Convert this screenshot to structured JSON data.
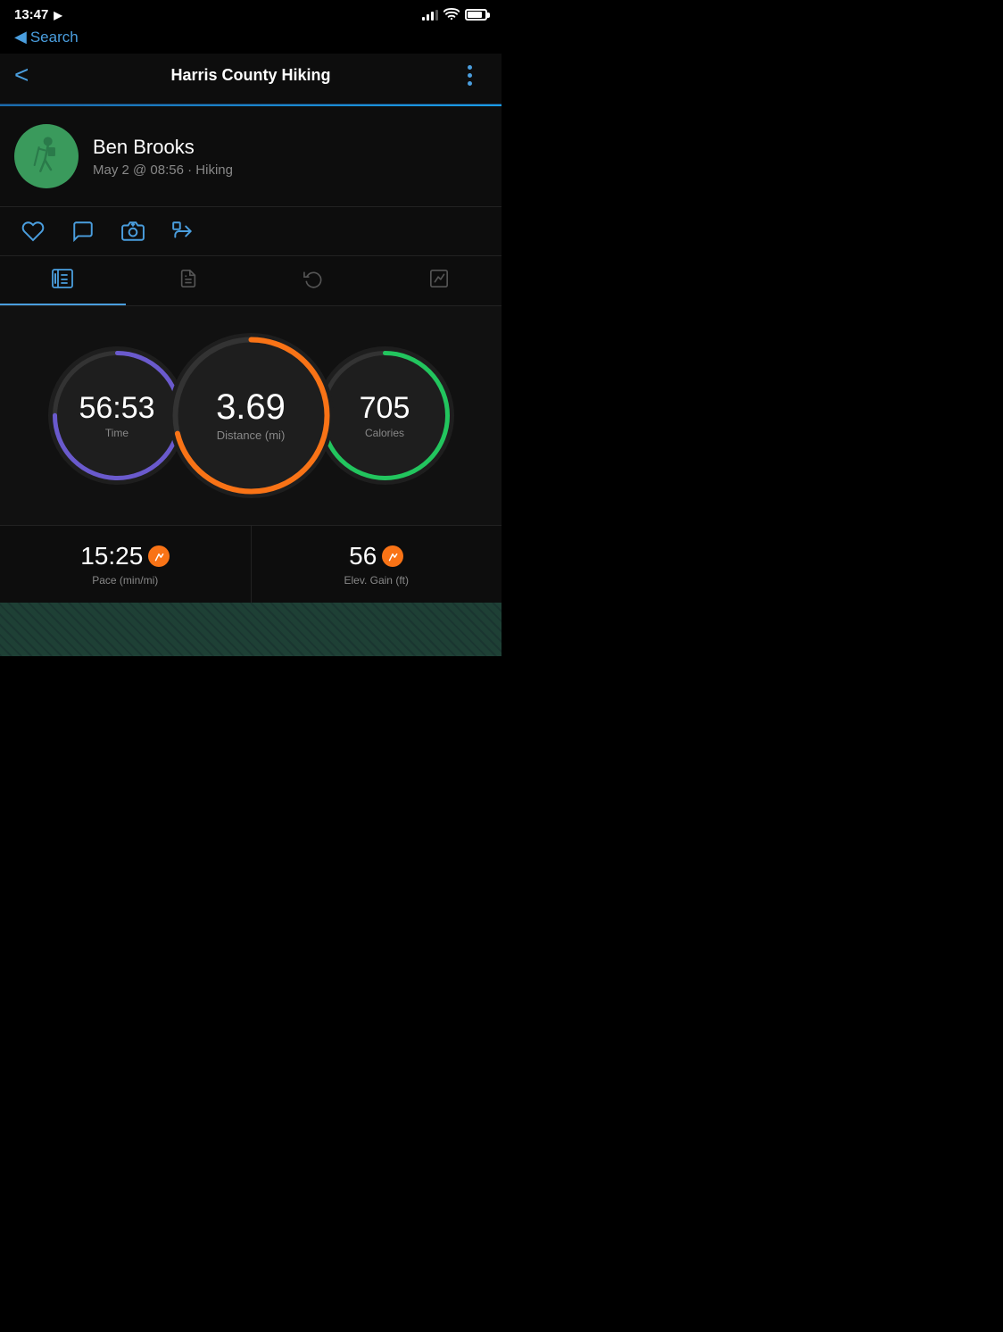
{
  "statusBar": {
    "time": "13:47",
    "locationArrow": "▶",
    "searchLabel": "Search"
  },
  "header": {
    "backLabel": "<",
    "title": "Harris County Hiking",
    "menuDots": [
      "●",
      "●",
      "●"
    ]
  },
  "user": {
    "name": "Ben Brooks",
    "meta": "May 2 @ 08:56 · Hiking"
  },
  "tabs": [
    {
      "id": "overview",
      "label": "Overview",
      "active": true
    },
    {
      "id": "splits",
      "label": "Splits",
      "active": false
    },
    {
      "id": "laps",
      "label": "Laps",
      "active": false
    },
    {
      "id": "chart",
      "label": "Chart",
      "active": false
    }
  ],
  "stats": {
    "time": {
      "value": "56:53",
      "label": "Time",
      "ringColor": "#6a5acd"
    },
    "distance": {
      "value": "3.69",
      "label": "Distance (mi)",
      "ringColor": "#f97316"
    },
    "calories": {
      "value": "705",
      "label": "Calories",
      "ringColor": "#22c55e"
    }
  },
  "bottomStats": {
    "pace": {
      "value": "15:25",
      "label": "Pace (min/mi)",
      "badge": "~"
    },
    "elevGain": {
      "value": "56",
      "label": "Elev. Gain (ft)",
      "badge": "~"
    }
  },
  "colors": {
    "accent": "#4a9ede",
    "background": "#0d0d0d",
    "dark": "#000",
    "ring_time": "#6a5acd",
    "ring_distance": "#f97316",
    "ring_calories": "#22c55e"
  }
}
